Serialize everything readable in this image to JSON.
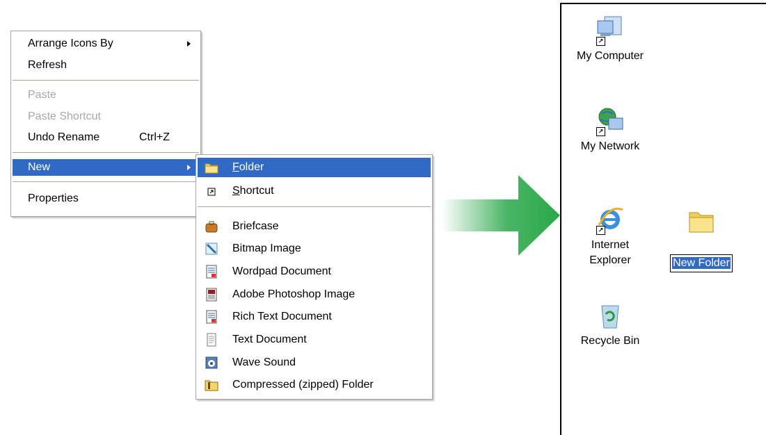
{
  "context_menu": {
    "items": [
      {
        "label": "Arrange Icons By",
        "has_submenu": true
      },
      {
        "label": "Refresh"
      },
      {
        "label": "Paste",
        "disabled": true
      },
      {
        "label": "Paste Shortcut",
        "disabled": true
      },
      {
        "label": "Undo Rename",
        "shortcut": "Ctrl+Z"
      },
      {
        "label": "New",
        "has_submenu": true,
        "highlighted": true
      },
      {
        "label": "Properties"
      }
    ]
  },
  "new_submenu": {
    "items": [
      {
        "label": "Folder",
        "accel": "F",
        "rest": "older",
        "icon": "folder-icon",
        "highlighted": true
      },
      {
        "label": "Shortcut",
        "accel": "S",
        "rest": "hortcut",
        "icon": "shortcut-icon"
      },
      {
        "label": "Briefcase",
        "icon": "briefcase-icon"
      },
      {
        "label": "Bitmap Image",
        "icon": "bitmap-image-icon"
      },
      {
        "label": "Wordpad Document",
        "icon": "wordpad-document-icon"
      },
      {
        "label": "Adobe Photoshop Image",
        "icon": "photoshop-image-icon"
      },
      {
        "label": "Rich Text Document",
        "icon": "rich-text-document-icon"
      },
      {
        "label": "Text Document",
        "icon": "text-document-icon"
      },
      {
        "label": "Wave Sound",
        "icon": "wave-sound-icon"
      },
      {
        "label": "Compressed (zipped) Folder",
        "icon": "zipped-folder-icon"
      }
    ]
  },
  "desktop": {
    "icons": [
      {
        "label": "My Computer",
        "icon": "my-computer-icon"
      },
      {
        "label": "My Network",
        "icon": "my-network-icon"
      },
      {
        "label": "Internet\nExplorer",
        "icon": "internet-explorer-icon"
      },
      {
        "label": "Recycle Bin",
        "icon": "recycle-bin-icon"
      }
    ],
    "new_folder": {
      "label": "New Folder",
      "icon": "folder-icon"
    }
  },
  "colors": {
    "highlight": "#316ac5",
    "disabled_text": "#a7a6aa",
    "arrow_green": "#2aa84a"
  }
}
